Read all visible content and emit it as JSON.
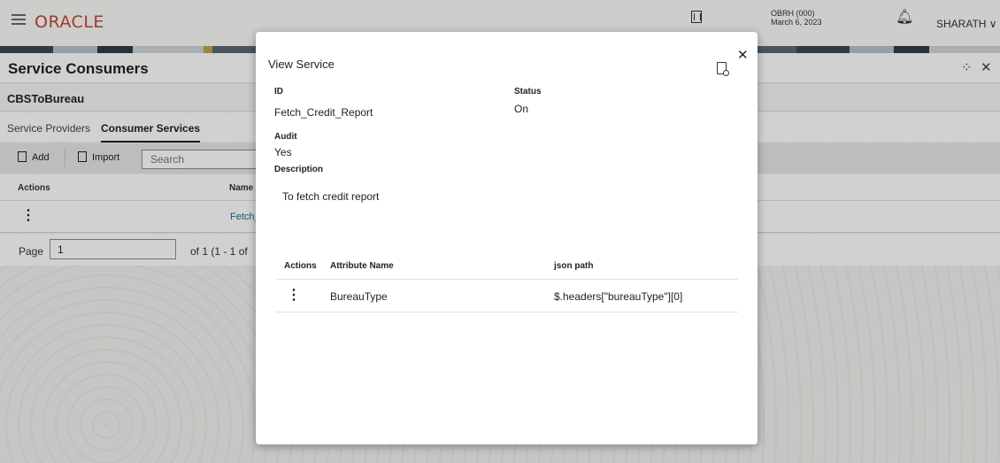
{
  "header": {
    "logo": "ORACLE",
    "branch_code": "OBRH (000)",
    "branch_date": "March 6, 2023",
    "user": "SHARATH ∨"
  },
  "page": {
    "title": "Service Consumers",
    "consumer_name": "CBSToBureau",
    "tabs": [
      "Service Providers",
      "Consumer Services"
    ],
    "active_tab": "Consumer Services",
    "toolbar": {
      "add_label": "Add",
      "import_label": "Import",
      "search_placeholder": "Search"
    },
    "grid_headers": {
      "actions": "Actions",
      "name": "Name"
    },
    "grid_rows": [
      {
        "name": "Fetch_"
      }
    ],
    "pager": {
      "label": "Page",
      "value": "1",
      "of_text": "of 1   (1 - 1 of"
    }
  },
  "modal": {
    "title": "View Service",
    "id_label": "ID",
    "id_value": "Fetch_Credit_Report",
    "status_label": "Status",
    "status_value": "On",
    "audit_label": "Audit",
    "audit_value": "Yes",
    "description_label": "Description",
    "description_value": "To fetch credit report",
    "table": {
      "headers": {
        "actions": "Actions",
        "attribute": "Attribute Name",
        "json_path": "json path"
      },
      "rows": [
        {
          "attribute": "BureauType",
          "json_path": "$.headers[\"bureauType\"][0]"
        }
      ]
    }
  },
  "icons": {
    "close": "close-icon",
    "edit_doc": "document-edit-icon",
    "kebab": "kebab-menu-icon"
  }
}
